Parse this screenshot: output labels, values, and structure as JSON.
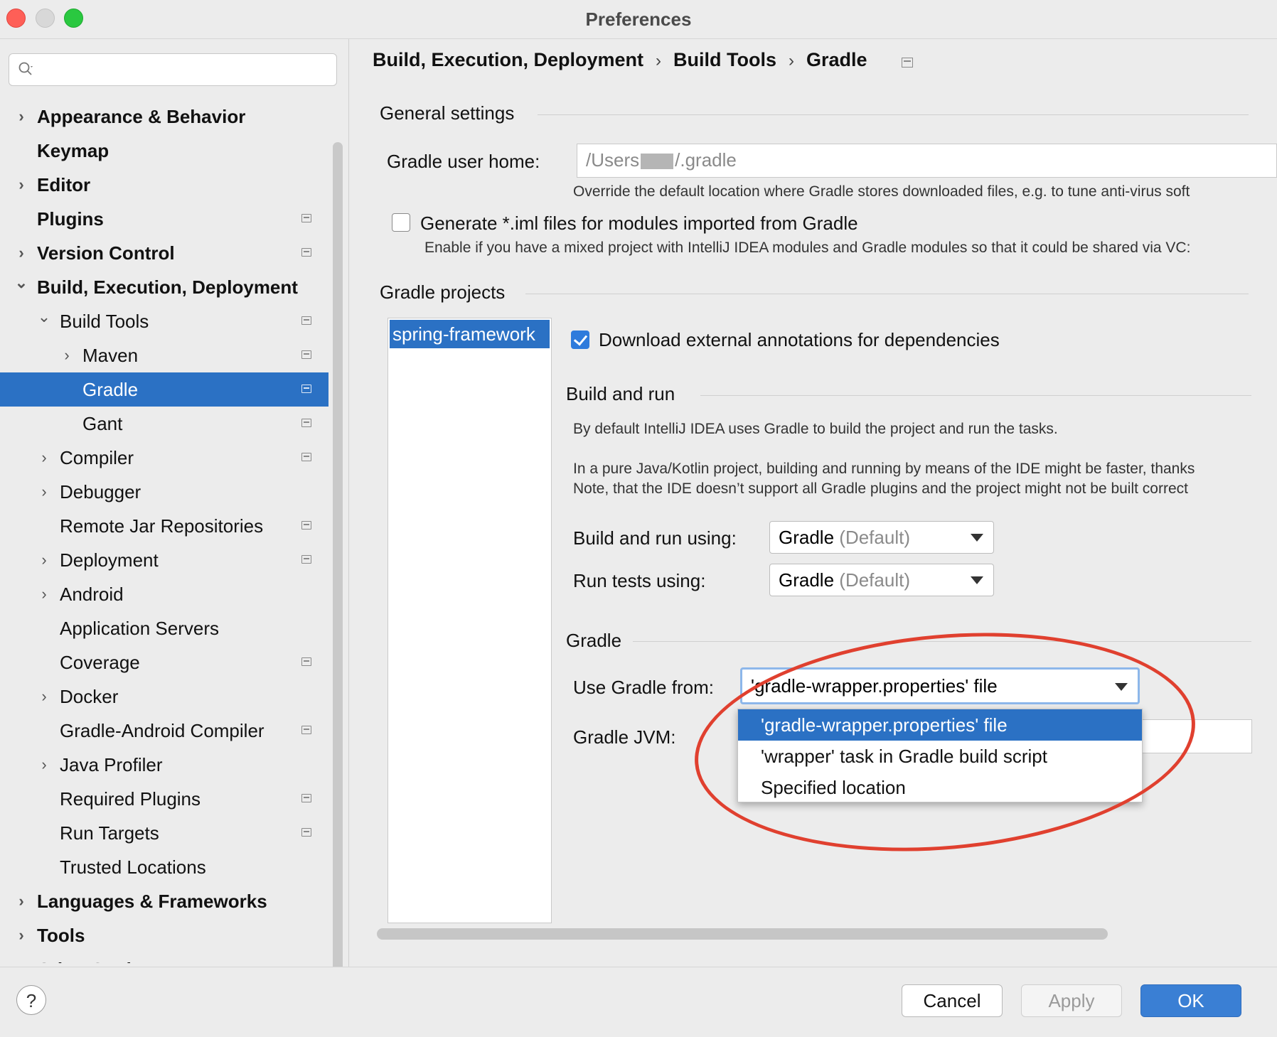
{
  "window": {
    "title": "Preferences"
  },
  "sidebar": {
    "search_placeholder": "",
    "items": [
      {
        "label": "Appearance & Behavior",
        "level": 0,
        "bold": true,
        "chevron": ">",
        "has_project_icon": false,
        "selected": false
      },
      {
        "label": "Keymap",
        "level": 0,
        "bold": true,
        "chevron": "",
        "has_project_icon": false,
        "selected": false
      },
      {
        "label": "Editor",
        "level": 0,
        "bold": true,
        "chevron": ">",
        "has_project_icon": false,
        "selected": false
      },
      {
        "label": "Plugins",
        "level": 0,
        "bold": true,
        "chevron": "",
        "has_project_icon": true,
        "selected": false
      },
      {
        "label": "Version Control",
        "level": 0,
        "bold": true,
        "chevron": ">",
        "has_project_icon": true,
        "selected": false
      },
      {
        "label": "Build, Execution, Deployment",
        "level": 0,
        "bold": true,
        "chevron": "v",
        "has_project_icon": false,
        "selected": false
      },
      {
        "label": "Build Tools",
        "level": 1,
        "bold": false,
        "chevron": "v",
        "has_project_icon": true,
        "selected": false
      },
      {
        "label": "Maven",
        "level": 2,
        "bold": false,
        "chevron": ">",
        "has_project_icon": true,
        "selected": false
      },
      {
        "label": "Gradle",
        "level": 2,
        "bold": false,
        "chevron": "",
        "has_project_icon": true,
        "selected": true
      },
      {
        "label": "Gant",
        "level": 2,
        "bold": false,
        "chevron": "",
        "has_project_icon": true,
        "selected": false
      },
      {
        "label": "Compiler",
        "level": 1,
        "bold": false,
        "chevron": ">",
        "has_project_icon": true,
        "selected": false
      },
      {
        "label": "Debugger",
        "level": 1,
        "bold": false,
        "chevron": ">",
        "has_project_icon": false,
        "selected": false
      },
      {
        "label": "Remote Jar Repositories",
        "level": 1,
        "bold": false,
        "chevron": "",
        "has_project_icon": true,
        "selected": false
      },
      {
        "label": "Deployment",
        "level": 1,
        "bold": false,
        "chevron": ">",
        "has_project_icon": true,
        "selected": false
      },
      {
        "label": "Android",
        "level": 1,
        "bold": false,
        "chevron": ">",
        "has_project_icon": false,
        "selected": false
      },
      {
        "label": "Application Servers",
        "level": 1,
        "bold": false,
        "chevron": "",
        "has_project_icon": false,
        "selected": false
      },
      {
        "label": "Coverage",
        "level": 1,
        "bold": false,
        "chevron": "",
        "has_project_icon": true,
        "selected": false
      },
      {
        "label": "Docker",
        "level": 1,
        "bold": false,
        "chevron": ">",
        "has_project_icon": false,
        "selected": false
      },
      {
        "label": "Gradle-Android Compiler",
        "level": 1,
        "bold": false,
        "chevron": "",
        "has_project_icon": true,
        "selected": false
      },
      {
        "label": "Java Profiler",
        "level": 1,
        "bold": false,
        "chevron": ">",
        "has_project_icon": false,
        "selected": false
      },
      {
        "label": "Required Plugins",
        "level": 1,
        "bold": false,
        "chevron": "",
        "has_project_icon": true,
        "selected": false
      },
      {
        "label": "Run Targets",
        "level": 1,
        "bold": false,
        "chevron": "",
        "has_project_icon": true,
        "selected": false
      },
      {
        "label": "Trusted Locations",
        "level": 1,
        "bold": false,
        "chevron": "",
        "has_project_icon": false,
        "selected": false
      },
      {
        "label": "Languages & Frameworks",
        "level": 0,
        "bold": true,
        "chevron": ">",
        "has_project_icon": false,
        "selected": false
      },
      {
        "label": "Tools",
        "level": 0,
        "bold": true,
        "chevron": ">",
        "has_project_icon": false,
        "selected": false
      },
      {
        "label": "Other Settings",
        "level": 0,
        "bold": true,
        "chevron": ">",
        "has_project_icon": false,
        "selected": false
      }
    ]
  },
  "breadcrumb": {
    "parts": [
      "Build, Execution, Deployment",
      "Build Tools",
      "Gradle"
    ],
    "separator": "›"
  },
  "general": {
    "section_title": "General settings",
    "user_home_label": "Gradle user home:",
    "user_home_prefix": "/Users",
    "user_home_suffix": "/.gradle",
    "user_home_hint": "Override the default location where Gradle stores downloaded files, e.g. to tune anti-virus soft",
    "iml_checkbox_label": "Generate *.iml files for modules imported from Gradle",
    "iml_checkbox_checked": false,
    "iml_hint": "Enable if you have a mixed project with IntelliJ IDEA modules and Gradle modules so that it could be shared via VC:"
  },
  "projects": {
    "section_title": "Gradle projects",
    "items": [
      "spring-framework"
    ],
    "download_annotations_label": "Download external annotations for dependencies",
    "download_annotations_checked": true
  },
  "build_and_run": {
    "section_title": "Build and run",
    "desc1": "By default IntelliJ IDEA uses Gradle to build the project and run the tasks.",
    "desc2": "In a pure Java/Kotlin project, building and running by means of the IDE might be faster, thanks",
    "desc3": "Note, that the IDE doesn’t support all Gradle plugins and the project might not be built correct",
    "build_using_label": "Build and run using:",
    "build_using_value": "Gradle",
    "build_using_default": "(Default)",
    "tests_using_label": "Run tests using:",
    "tests_using_value": "Gradle",
    "tests_using_default": "(Default)"
  },
  "gradle": {
    "section_title": "Gradle",
    "use_from_label": "Use Gradle from:",
    "use_from_value": "'gradle-wrapper.properties' file",
    "jvm_label": "Gradle JVM:",
    "dropdown_options": [
      "'gradle-wrapper.properties' file",
      "'wrapper' task in Gradle build script",
      "Specified location"
    ],
    "dropdown_selected_index": 0
  },
  "buttons": {
    "help": "?",
    "cancel": "Cancel",
    "apply": "Apply",
    "ok": "OK"
  },
  "colors": {
    "selection": "#2b71c4",
    "ok_button": "#3a7fd4",
    "annotation": "#e0402f"
  }
}
